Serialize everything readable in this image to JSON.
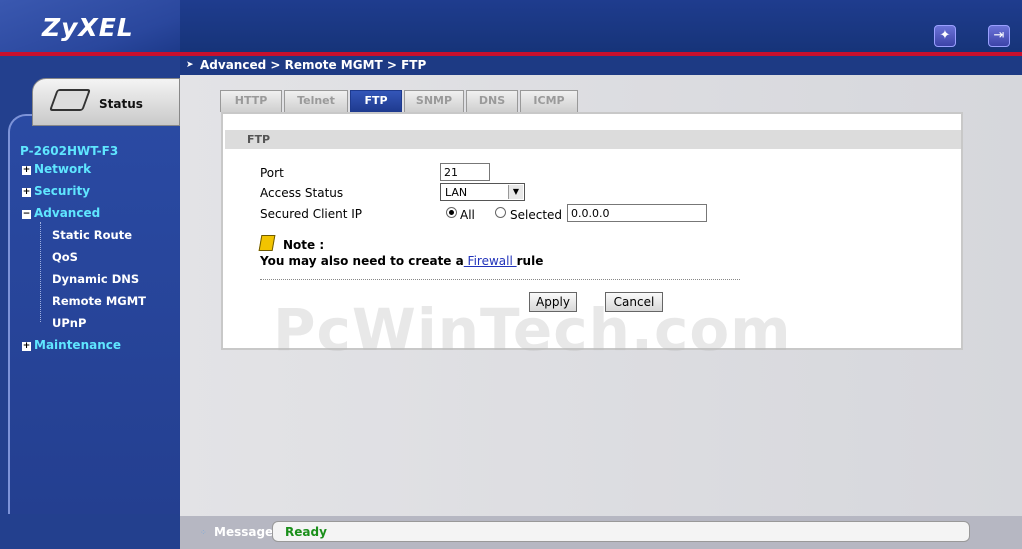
{
  "brand": {
    "logo": "ZyXEL"
  },
  "header": {
    "icons": [
      "wizard-icon",
      "logout-icon"
    ]
  },
  "sidebar": {
    "status_label": "Status",
    "device_name": "P-2602HWT-F3",
    "items": [
      {
        "label": "Network",
        "expander": "+"
      },
      {
        "label": "Security",
        "expander": "+"
      },
      {
        "label": "Advanced",
        "expander": "−"
      },
      {
        "label": "Maintenance",
        "expander": "+"
      }
    ],
    "subitems": [
      "Static Route",
      "QoS",
      "Dynamic DNS",
      "Remote MGMT",
      "UPnP"
    ]
  },
  "breadcrumb": "Advanced > Remote MGMT > FTP",
  "tabs": [
    "HTTP",
    "Telnet",
    "FTP",
    "SNMP",
    "DNS",
    "ICMP"
  ],
  "active_tab": "FTP",
  "form": {
    "section_title": "FTP",
    "port_label": "Port",
    "port_value": "21",
    "access_status_label": "Access Status",
    "access_status_value": "LAN",
    "secured_client_ip_label": "Secured Client IP",
    "radio_all_label": "All",
    "radio_selected_label": "Selected",
    "selected_ip_value": "0.0.0.0"
  },
  "note": {
    "title": "Note :",
    "text_before": "You may also need to create a",
    "link": " Firewall ",
    "text_after": "rule"
  },
  "buttons": {
    "apply": "Apply",
    "cancel": "Cancel"
  },
  "watermark": "PcWinTech.com",
  "message": {
    "label": "Message",
    "status": "Ready",
    "status_color": "#1a8f1a"
  }
}
